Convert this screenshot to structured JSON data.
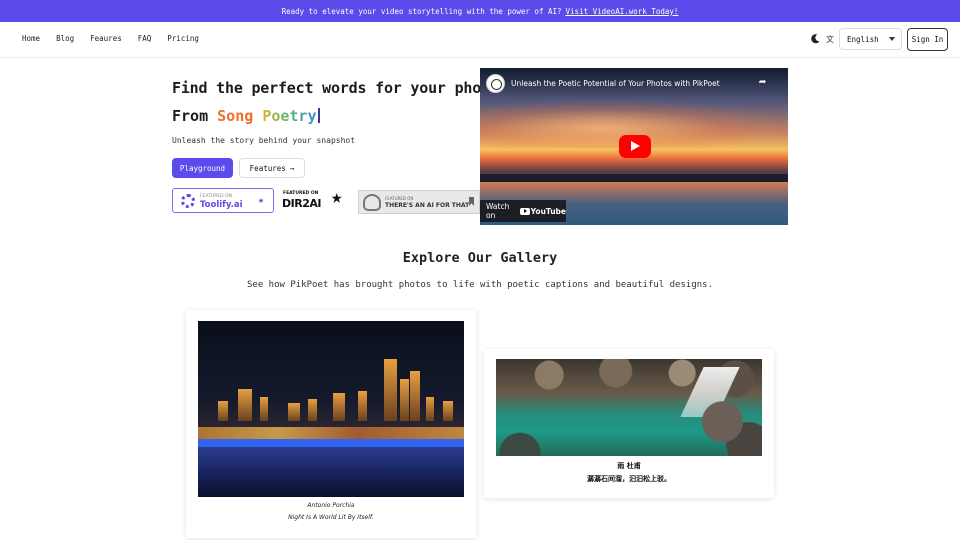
{
  "banner": {
    "text": "Ready to elevate your video storytelling with the power of AI?",
    "link": "Visit VideoAI.work Today!"
  },
  "nav": {
    "links": [
      "Home",
      "Blog",
      "Feaures",
      "FAQ",
      "Pricing"
    ],
    "language": "English",
    "signin": "Sign In",
    "icons": [
      "moon-icon",
      "translate-icon",
      "chevron-down-icon"
    ]
  },
  "hero": {
    "title": "Find the perfect words for your photos",
    "prefix": "From",
    "word1": "Song",
    "word2": "Poetry",
    "subtitle": "Unleash the story behind your snapshot",
    "primary_button": "Playground",
    "secondary_button": "Features",
    "arrow": "→"
  },
  "badges": {
    "toolify_small": "FEATURED ON",
    "toolify_big": "Toolify.ai",
    "dir2ai_small": "FEATURED ON",
    "dir2ai_big": "DIR2AI",
    "aifor_small": "FEATURED ON",
    "aifor_big": "THERE'S AN AI FOR THAT"
  },
  "video": {
    "title": "Unleash the Poetic Potential of Your Photos with PikPoet",
    "watch_on": "Watch on",
    "youtube": "YouTube"
  },
  "gallery": {
    "title": "Explore Our Gallery",
    "subtitle": "See how PikPoet has brought photos to life with poetic captions and beautiful designs.",
    "cards": [
      {
        "line1": "Antonio Porchia",
        "line2": "Night Is A World Lit By Itself."
      },
      {
        "line1": "雨 杜甫",
        "line2": "潺潺石间溜，汩汩松上驳。"
      }
    ]
  },
  "colors": {
    "brand": "#5a4bea",
    "song": "#f0702a"
  }
}
